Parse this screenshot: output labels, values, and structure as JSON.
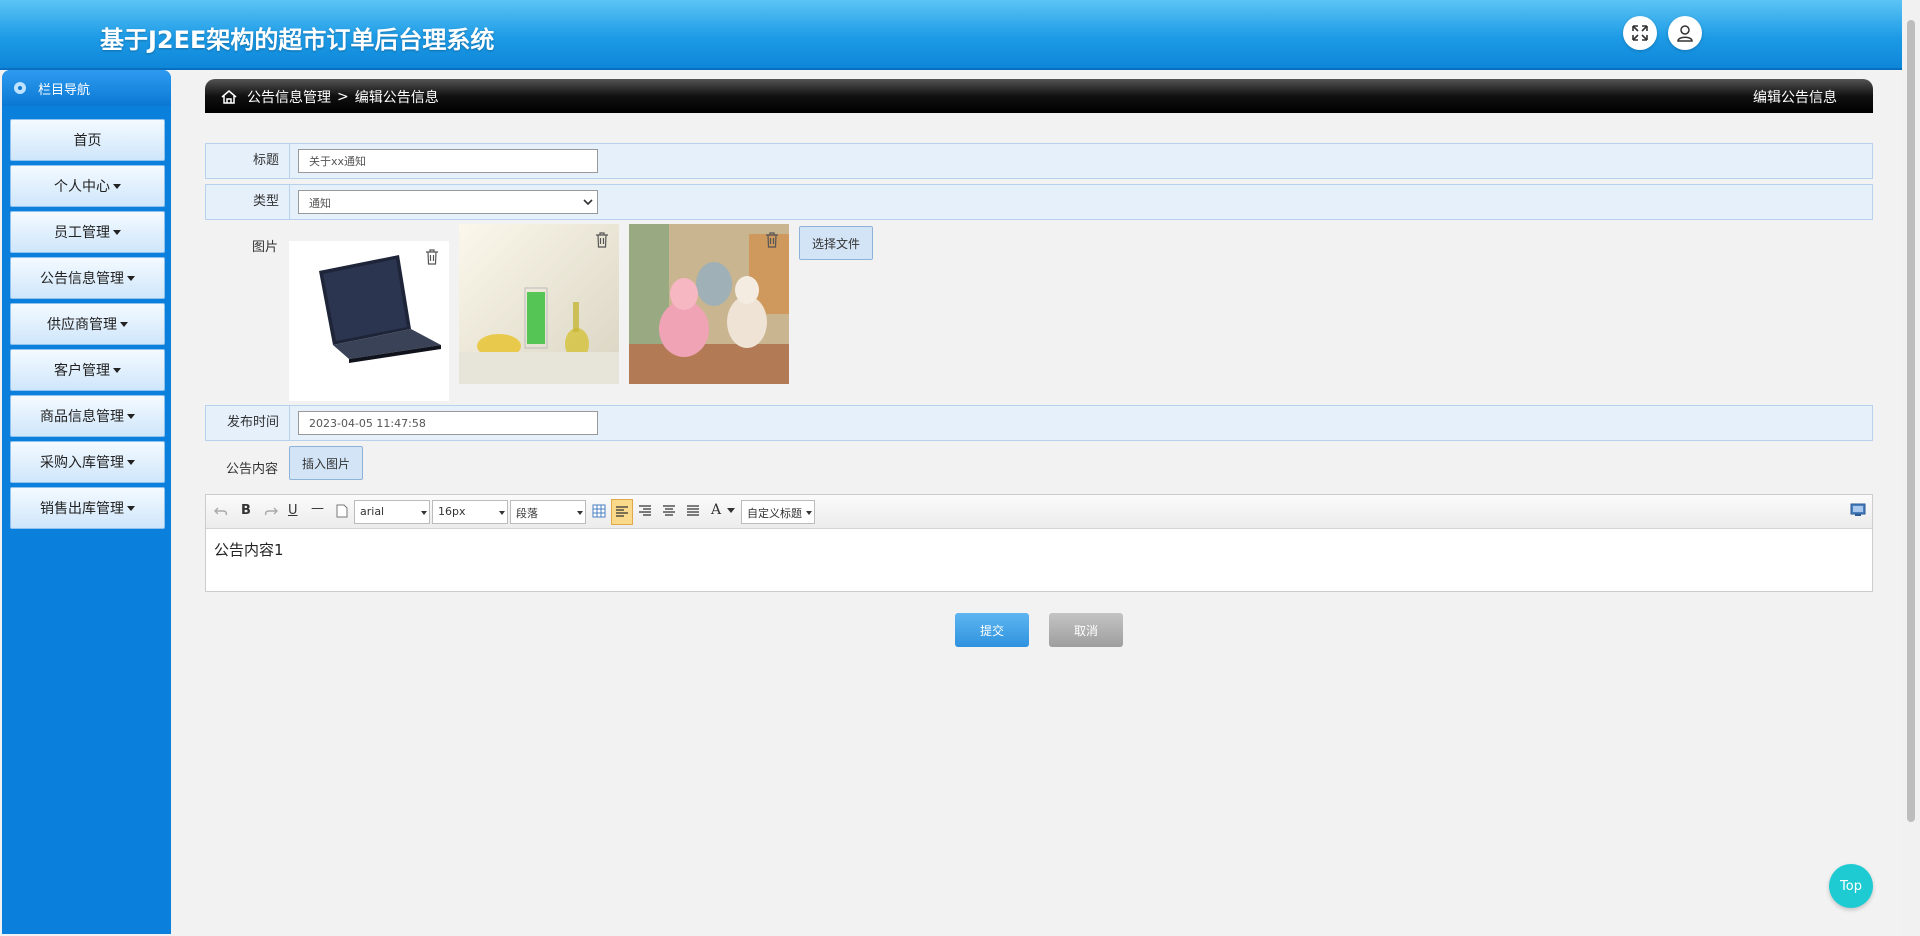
{
  "header": {
    "title": "基于J2EE架构的超市订单后台理系统",
    "fullscreen_icon": "expand-icon",
    "user_icon": "user-icon"
  },
  "sidebar": {
    "title": "栏目导航",
    "items": [
      {
        "label": "首页",
        "dropdown": false
      },
      {
        "label": "个人中心",
        "dropdown": true
      },
      {
        "label": "员工管理",
        "dropdown": true
      },
      {
        "label": "公告信息管理",
        "dropdown": true
      },
      {
        "label": "供应商管理",
        "dropdown": true
      },
      {
        "label": "客户管理",
        "dropdown": true
      },
      {
        "label": "商品信息管理",
        "dropdown": true
      },
      {
        "label": "采购入库管理",
        "dropdown": true
      },
      {
        "label": "销售出库管理",
        "dropdown": true
      }
    ]
  },
  "breadcrumb": {
    "section": "公告信息管理",
    "separator": ">",
    "page": "编辑公告信息",
    "right_title": "编辑公告信息"
  },
  "form": {
    "title_label": "标题",
    "title_value": "关于xx通知",
    "type_label": "类型",
    "type_value": "通知",
    "image_label": "图片",
    "choose_file": "选择文件",
    "publish_label": "发布时间",
    "publish_value": "2023-04-05 11:47:58",
    "content_label": "公告内容",
    "insert_image": "插入图片"
  },
  "editor": {
    "font_family": "arial",
    "font_size": "16px",
    "paragraph": "段落",
    "custom_title": "自定义标题",
    "content": "公告内容1"
  },
  "actions": {
    "submit": "提交",
    "cancel": "取消"
  },
  "top_button": "Top",
  "colors": {
    "header": "#1d9be6",
    "sidebar": "#0a7fdb",
    "submit": "#3aa0e8",
    "cancel": "#a9a9a9",
    "top": "#1ecbd2"
  }
}
